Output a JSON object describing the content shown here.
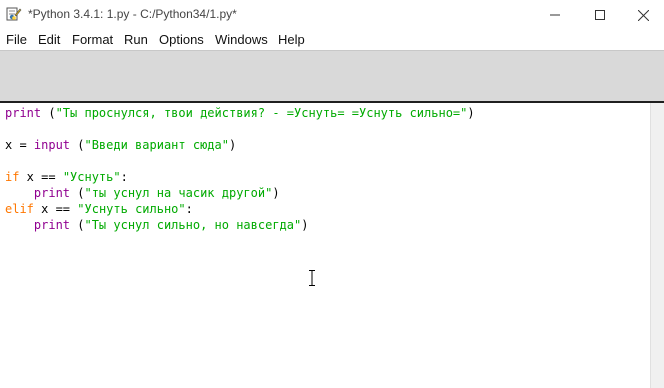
{
  "window": {
    "title": "*Python 3.4.1: 1.py - C:/Python34/1.py*",
    "icons": {
      "app": "python-idle-icon",
      "minimize": "minimize-icon",
      "maximize": "maximize-icon",
      "close": "close-icon"
    }
  },
  "menu": {
    "items": [
      "File",
      "Edit",
      "Format",
      "Run",
      "Options",
      "Windows",
      "Help"
    ]
  },
  "colors": {
    "keyword": "#ff7700",
    "builtin": "#900090",
    "string": "#00aa00",
    "toolbar_bg": "#d9d9d9"
  },
  "editor": {
    "lines": [
      {
        "t1": "print",
        "t2": " (",
        "t3": "\"Ты проснулся, твои действия? - =Уснуть= =Уснуть сильно=\"",
        "t4": ")"
      },
      {
        "t1": "x = ",
        "t2": "input",
        "t3": " (",
        "t4": "\"Введи вариант сюда\"",
        "t5": ")"
      },
      {
        "t1": "if",
        "t2": " x == ",
        "t3": "\"Уснуть\"",
        "t4": ":"
      },
      {
        "t1": "    ",
        "t2": "print",
        "t3": " (",
        "t4": "\"ты уснул на часик другой\"",
        "t5": ")"
      },
      {
        "t1": "elif",
        "t2": " x == ",
        "t3": "\"Уснуть сильно\"",
        "t4": ":"
      },
      {
        "t1": "    ",
        "t2": "print",
        "t3": " (",
        "t4": "\"Ты уснул сильно, но навсегда\"",
        "t5": ")"
      }
    ],
    "mouse_cursor": "text-cursor-icon"
  }
}
